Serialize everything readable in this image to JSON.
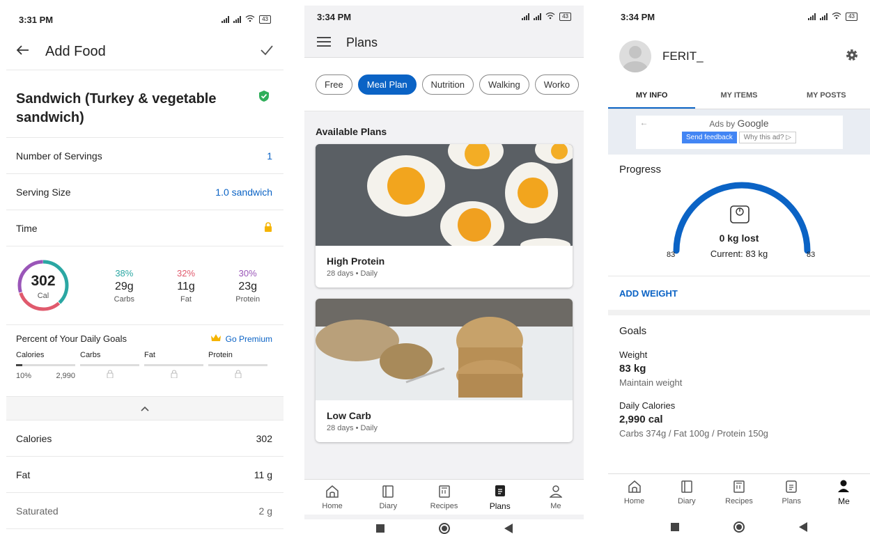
{
  "screen1": {
    "status_time": "3:31 PM",
    "battery": "43",
    "title": "Add Food",
    "food_name": "Sandwich (Turkey & vegetable sandwich)",
    "rows": [
      {
        "label": "Number of Servings",
        "value": "1"
      },
      {
        "label": "Serving Size",
        "value": "1.0 sandwich"
      },
      {
        "label": "Time",
        "value": ""
      }
    ],
    "calories": {
      "value": "302",
      "unit": "Cal"
    },
    "macros": [
      {
        "pct": "38%",
        "grams": "29g",
        "label": "Carbs",
        "color": "#2ba7a3"
      },
      {
        "pct": "32%",
        "grams": "11g",
        "label": "Fat",
        "color": "#e05a6d"
      },
      {
        "pct": "30%",
        "grams": "23g",
        "label": "Protein",
        "color": "#9a56b8"
      }
    ],
    "goals": {
      "title": "Percent of Your Daily Goals",
      "premium": "Go Premium",
      "cols": [
        "Calories",
        "Carbs",
        "Fat",
        "Protein"
      ],
      "cal_pct": "10%",
      "cal_goal": "2,990"
    },
    "nutrients": [
      {
        "label": "Calories",
        "value": "302"
      },
      {
        "label": "Fat",
        "value": "11 g"
      },
      {
        "label": "Saturated",
        "value": "2 g"
      }
    ]
  },
  "screen2": {
    "status_time": "3:34 PM",
    "battery": "43",
    "title": "Plans",
    "chips": [
      "Free",
      "Meal Plan",
      "Nutrition",
      "Walking",
      "Worko"
    ],
    "section": "Available Plans",
    "plans": [
      {
        "title": "High Protein",
        "sub": "28 days • Daily"
      },
      {
        "title": "Low Carb",
        "sub": "28 days • Daily"
      }
    ],
    "nav": [
      "Home",
      "Diary",
      "Recipes",
      "Plans",
      "Me"
    ]
  },
  "screen3": {
    "status_time": "3:34 PM",
    "battery": "43",
    "username": "FERIT_",
    "tabs": [
      "MY INFO",
      "MY ITEMS",
      "MY POSTS"
    ],
    "ad": {
      "label": "Ads by",
      "brand": "Google",
      "feedback": "Send feedback",
      "why": "Why this ad? ▷"
    },
    "progress": {
      "title": "Progress",
      "lost": "0 kg lost",
      "current": "Current: 83 kg",
      "start": "83",
      "goal": "83"
    },
    "add_weight": "ADD WEIGHT",
    "goals": {
      "title": "Goals",
      "weight_label": "Weight",
      "weight_value": "83 kg",
      "weight_note": "Maintain weight",
      "cal_label": "Daily Calories",
      "cal_value": "2,990 cal",
      "cal_note": "Carbs 374g / Fat 100g / Protein 150g"
    },
    "nav": [
      "Home",
      "Diary",
      "Recipes",
      "Plans",
      "Me"
    ]
  },
  "colors": {
    "accent": "#0b63c5",
    "premium": "#f5b400",
    "lock": "#f5b400"
  }
}
